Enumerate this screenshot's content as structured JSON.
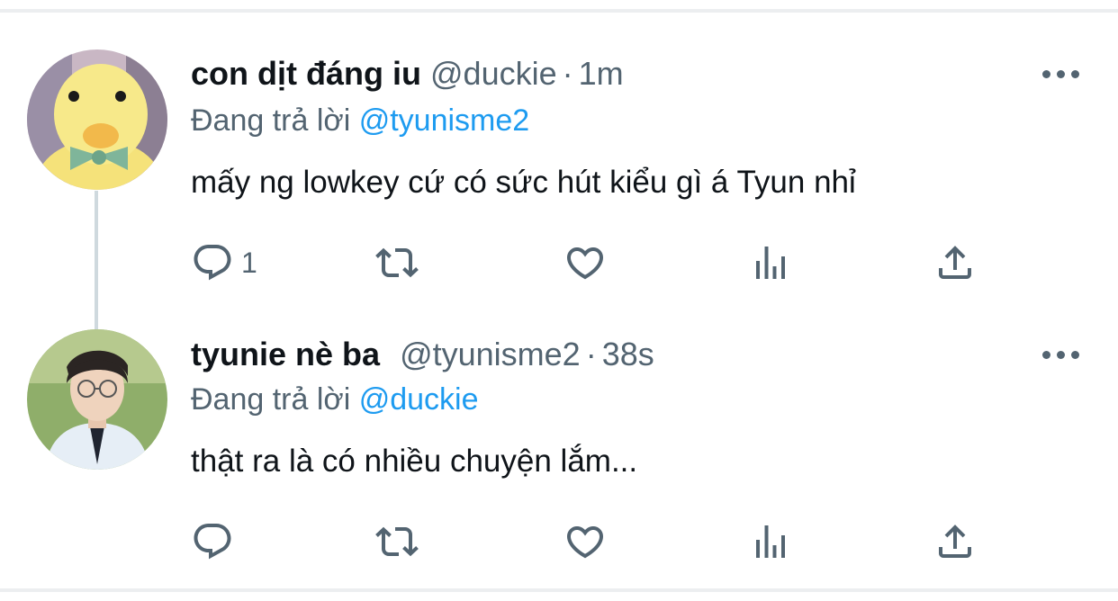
{
  "tweets": [
    {
      "display_name": "con dịt đáng iu",
      "handle": "@duckie",
      "separator": "·",
      "time": "1m",
      "replying_prefix": "Đang trả lời",
      "replying_to": "@tyunisme2",
      "text": "mấy ng lowkey cứ có sức hút kiểu gì á Tyun nhỉ",
      "reply_count": "1",
      "avatar": "yellow-duck-plush-avatar"
    },
    {
      "display_name": "tyunie nè ba",
      "handle": "@tyunisme2",
      "separator": "·",
      "time": "38s",
      "replying_prefix": "Đang trả lời",
      "replying_to": "@duckie",
      "text": "thật ra là có nhiều chuyện lắm...",
      "reply_count": "",
      "avatar": "person-with-glasses-avatar"
    }
  ],
  "icons": [
    "reply-icon",
    "retweet-icon",
    "like-icon",
    "views-icon",
    "share-icon",
    "more-icon"
  ],
  "colors": {
    "text": "#0f1419",
    "secondary": "#536471",
    "mention": "#1d9bf0",
    "divider": "#eceef0",
    "thread_line": "#cfd9de"
  }
}
